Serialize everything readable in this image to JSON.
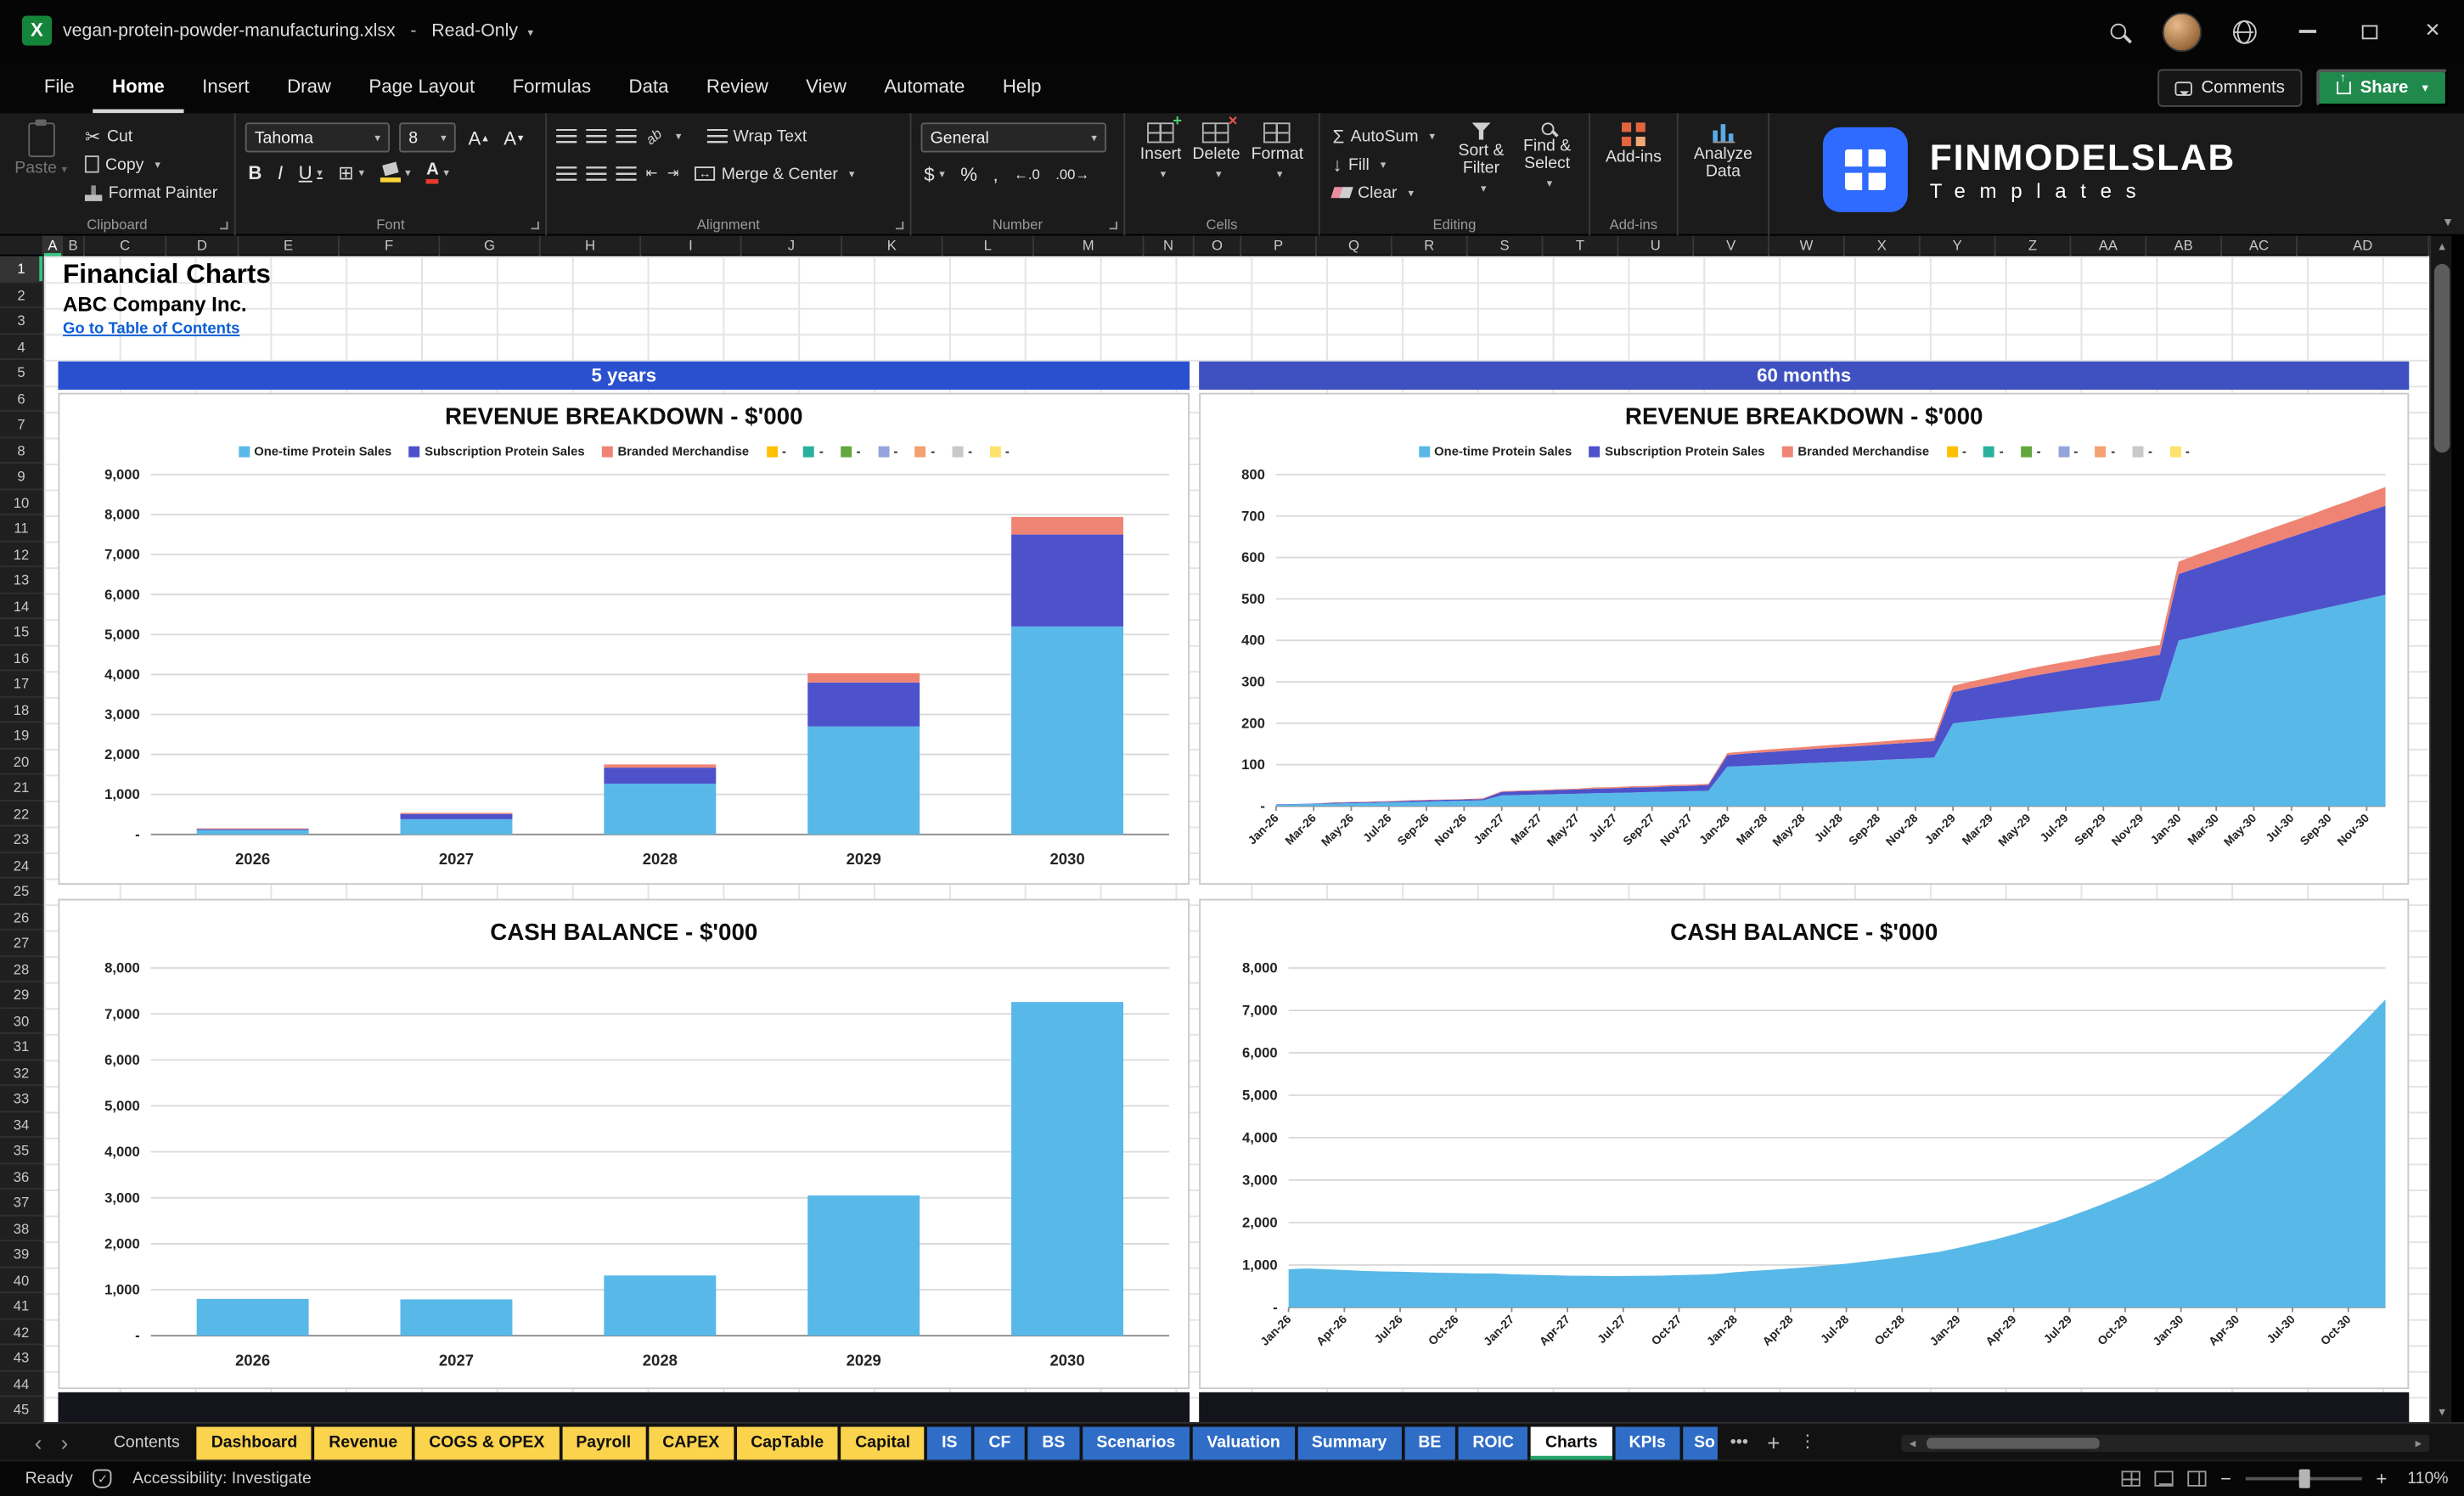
{
  "titlebar": {
    "doc": "vegan-protein-powder-manufacturing.xlsx",
    "sep": "-",
    "mode": "Read-Only"
  },
  "menubar": {
    "tabs": [
      "File",
      "Home",
      "Insert",
      "Draw",
      "Page Layout",
      "Formulas",
      "Data",
      "Review",
      "View",
      "Automate",
      "Help"
    ],
    "active": "Home",
    "comments_label": "Comments",
    "share_label": "Share"
  },
  "ribbon": {
    "clipboard": {
      "group": "Clipboard",
      "paste": "Paste",
      "cut": "Cut",
      "copy": "Copy",
      "format_painter": "Format Painter"
    },
    "font": {
      "group": "Font",
      "family": "Tahoma",
      "size": "8",
      "bold": "B",
      "italic": "I",
      "underline": "U"
    },
    "alignment": {
      "group": "Alignment",
      "wrap": "Wrap Text",
      "merge": "Merge & Center"
    },
    "number": {
      "group": "Number",
      "format": "General",
      "currency": "$",
      "percent": "%",
      "comma": ","
    },
    "cells": {
      "group": "Cells",
      "insert": "Insert",
      "delete": "Delete",
      "format": "Format"
    },
    "editing": {
      "group": "Editing",
      "autosum": "AutoSum",
      "fill": "Fill",
      "clear": "Clear",
      "sort_filter": "Sort & Filter",
      "find_select": "Find & Select"
    },
    "addins": {
      "group": "Add-ins",
      "addins": "Add-ins",
      "analyze": "Analyze Data"
    }
  },
  "brand": {
    "name": "FINMODELSLAB",
    "tagline": "Templates"
  },
  "sheet": {
    "title": "Financial Charts",
    "company": "ABC Company Inc.",
    "toc_link": "Go to Table of Contents",
    "band_left": "5 years",
    "band_right": "60 months",
    "columns": [
      "A",
      "B",
      "C",
      "D",
      "E",
      "F",
      "G",
      "H",
      "I",
      "J",
      "K",
      "L",
      "M",
      "N",
      "O",
      "P",
      "Q",
      "R",
      "S",
      "T",
      "U",
      "V",
      "W",
      "X",
      "Y",
      "Z",
      "AA",
      "AB",
      "AC",
      "AD"
    ],
    "first_row": 1,
    "last_row": 45
  },
  "revenue_legend": [
    {
      "label": "One-time Protein Sales",
      "color": "#58b8e8"
    },
    {
      "label": "Subscription Protein Sales",
      "color": "#4d52cb"
    },
    {
      "label": "Branded Merchandise",
      "color": "#ef8474"
    },
    {
      "label": "-",
      "color": "#fec000"
    },
    {
      "label": "-",
      "color": "#2bb09e"
    },
    {
      "label": "-",
      "color": "#63a83e"
    },
    {
      "label": "-",
      "color": "#95a3dc"
    },
    {
      "label": "-",
      "color": "#f2a170"
    },
    {
      "label": "-",
      "color": "#c9c9c9"
    },
    {
      "label": "-",
      "color": "#ffe16e"
    }
  ],
  "chart_data": [
    {
      "type": "stacked_bar",
      "title": "REVENUE BREAKDOWN - $'000",
      "categories": [
        "2026",
        "2027",
        "2028",
        "2029",
        "2030"
      ],
      "series": [
        {
          "name": "One-time Protein Sales",
          "color": "#58b8e8",
          "values": [
            110,
            380,
            1270,
            2700,
            5200
          ]
        },
        {
          "name": "Subscription Protein Sales",
          "color": "#4d52cb",
          "values": [
            30,
            130,
            400,
            1100,
            2300
          ]
        },
        {
          "name": "Branded Merchandise",
          "color": "#ef8474",
          "values": [
            10,
            30,
            80,
            230,
            440
          ]
        }
      ],
      "ymax": 9000,
      "ystep": 1000,
      "grid": true,
      "legend_position": "top"
    },
    {
      "type": "stacked_area",
      "title": "REVENUE BREAKDOWN - $'000",
      "x": [
        "Jan-26",
        "Feb-26",
        "Mar-26",
        "Apr-26",
        "May-26",
        "Jun-26",
        "Jul-26",
        "Aug-26",
        "Sep-26",
        "Oct-26",
        "Nov-26",
        "Dec-26",
        "Jan-27",
        "Feb-27",
        "Mar-27",
        "Apr-27",
        "May-27",
        "Jun-27",
        "Jul-27",
        "Aug-27",
        "Sep-27",
        "Oct-27",
        "Nov-27",
        "Dec-27",
        "Jan-28",
        "Feb-28",
        "Mar-28",
        "Apr-28",
        "May-28",
        "Jun-28",
        "Jul-28",
        "Aug-28",
        "Sep-28",
        "Oct-28",
        "Nov-28",
        "Dec-28",
        "Jan-29",
        "Feb-29",
        "Mar-29",
        "Apr-29",
        "May-29",
        "Jun-29",
        "Jul-29",
        "Aug-29",
        "Sep-29",
        "Oct-29",
        "Nov-29",
        "Dec-29",
        "Jan-30",
        "Feb-30",
        "Mar-30",
        "Apr-30",
        "May-30",
        "Jun-30",
        "Jul-30",
        "Aug-30",
        "Sep-30",
        "Oct-30",
        "Nov-30",
        "Dec-30"
      ],
      "label_every": 2,
      "series": [
        {
          "name": "One-time Protein Sales",
          "color": "#58b8e8",
          "values": [
            3,
            4,
            5,
            6,
            7,
            8,
            9,
            10,
            11,
            12,
            13,
            14,
            26,
            27,
            28,
            29,
            30,
            31,
            32,
            33,
            34,
            35,
            36,
            37,
            95,
            97,
            99,
            101,
            103,
            105,
            107,
            109,
            111,
            113,
            115,
            117,
            200,
            205,
            210,
            215,
            220,
            225,
            230,
            235,
            240,
            245,
            250,
            255,
            400,
            410,
            420,
            430,
            440,
            450,
            460,
            470,
            480,
            490,
            500,
            510
          ]
        },
        {
          "name": "Subscription Protein Sales",
          "color": "#4d52cb",
          "values": [
            1,
            1,
            1,
            2,
            2,
            2,
            2,
            3,
            3,
            3,
            3,
            3,
            8,
            9,
            9,
            10,
            10,
            11,
            11,
            12,
            12,
            13,
            13,
            14,
            28,
            30,
            31,
            32,
            33,
            34,
            35,
            36,
            37,
            38,
            39,
            40,
            75,
            80,
            84,
            88,
            92,
            95,
            98,
            100,
            103,
            105,
            108,
            110,
            160,
            165,
            170,
            175,
            180,
            185,
            190,
            195,
            200,
            205,
            210,
            215
          ]
        },
        {
          "name": "Branded Merchandise",
          "color": "#ef8474",
          "values": [
            0,
            0,
            0,
            1,
            1,
            1,
            1,
            1,
            1,
            1,
            1,
            2,
            2,
            2,
            2,
            2,
            2,
            3,
            3,
            3,
            3,
            3,
            3,
            3,
            5,
            5,
            6,
            6,
            6,
            7,
            7,
            7,
            7,
            8,
            8,
            8,
            15,
            16,
            17,
            18,
            19,
            20,
            20,
            21,
            22,
            22,
            23,
            24,
            30,
            32,
            33,
            34,
            35,
            36,
            37,
            38,
            40,
            41,
            43,
            45
          ]
        }
      ],
      "ymax": 800,
      "ystep": 100,
      "grid": true,
      "legend_position": "top"
    },
    {
      "type": "bar",
      "title": "CASH BALANCE - $'000",
      "categories": [
        "2026",
        "2027",
        "2028",
        "2029",
        "2030"
      ],
      "series": [
        {
          "name": "Cash balance",
          "color": "#58b8e8",
          "values": [
            800,
            790,
            1310,
            3050,
            7260
          ]
        }
      ],
      "ymax": 8000,
      "ystep": 1000,
      "grid": true
    },
    {
      "type": "area",
      "title": "CASH BALANCE - $'000",
      "x": [
        "Jan-26",
        "Feb-26",
        "Mar-26",
        "Apr-26",
        "May-26",
        "Jun-26",
        "Jul-26",
        "Aug-26",
        "Sep-26",
        "Oct-26",
        "Nov-26",
        "Dec-26",
        "Jan-27",
        "Feb-27",
        "Mar-27",
        "Apr-27",
        "May-27",
        "Jun-27",
        "Jul-27",
        "Aug-27",
        "Sep-27",
        "Oct-27",
        "Nov-27",
        "Dec-27",
        "Jan-28",
        "Feb-28",
        "Mar-28",
        "Apr-28",
        "May-28",
        "Jun-28",
        "Jul-28",
        "Aug-28",
        "Sep-28",
        "Oct-28",
        "Nov-28",
        "Dec-28",
        "Jan-29",
        "Feb-29",
        "Mar-29",
        "Apr-29",
        "May-29",
        "Jun-29",
        "Jul-29",
        "Aug-29",
        "Sep-29",
        "Oct-29",
        "Nov-29",
        "Dec-29",
        "Jan-30",
        "Feb-30",
        "Mar-30",
        "Apr-30",
        "May-30",
        "Jun-30",
        "Jul-30",
        "Aug-30",
        "Sep-30",
        "Oct-30",
        "Nov-30",
        "Dec-30"
      ],
      "label_every": 3,
      "series": [
        {
          "name": "Cash balance",
          "color": "#58b8e8",
          "values": [
            900,
            920,
            900,
            880,
            860,
            850,
            840,
            830,
            820,
            810,
            800,
            800,
            780,
            770,
            760,
            750,
            745,
            740,
            740,
            745,
            750,
            760,
            770,
            790,
            830,
            860,
            890,
            920,
            950,
            990,
            1030,
            1080,
            1130,
            1190,
            1250,
            1310,
            1400,
            1500,
            1600,
            1720,
            1850,
            1990,
            2140,
            2300,
            2470,
            2650,
            2840,
            3050,
            3300,
            3560,
            3840,
            4140,
            4460,
            4800,
            5160,
            5540,
            5940,
            6360,
            6800,
            7260
          ]
        }
      ],
      "ymax": 8000,
      "ystep": 1000,
      "grid": true
    }
  ],
  "sheet_tabs": [
    {
      "label": "Contents",
      "style": "plain"
    },
    {
      "label": "Dashboard",
      "style": "yellow"
    },
    {
      "label": "Revenue",
      "style": "yellow"
    },
    {
      "label": "COGS & OPEX",
      "style": "yellow"
    },
    {
      "label": "Payroll",
      "style": "yellow"
    },
    {
      "label": "CAPEX",
      "style": "yellow"
    },
    {
      "label": "CapTable",
      "style": "yellow"
    },
    {
      "label": "Capital",
      "style": "yellow"
    },
    {
      "label": "IS",
      "style": "blue"
    },
    {
      "label": "CF",
      "style": "blue"
    },
    {
      "label": "BS",
      "style": "blue"
    },
    {
      "label": "Scenarios",
      "style": "blue"
    },
    {
      "label": "Valuation",
      "style": "blue"
    },
    {
      "label": "Summary",
      "style": "blue"
    },
    {
      "label": "BE",
      "style": "blue"
    },
    {
      "label": "ROIC",
      "style": "blue"
    },
    {
      "label": "Charts",
      "style": "active"
    },
    {
      "label": "KPIs",
      "style": "blue"
    },
    {
      "label": "So",
      "style": "blue",
      "cut": true
    }
  ],
  "statusbar": {
    "ready": "Ready",
    "accessibility": "Accessibility: Investigate",
    "zoom": "110%"
  }
}
